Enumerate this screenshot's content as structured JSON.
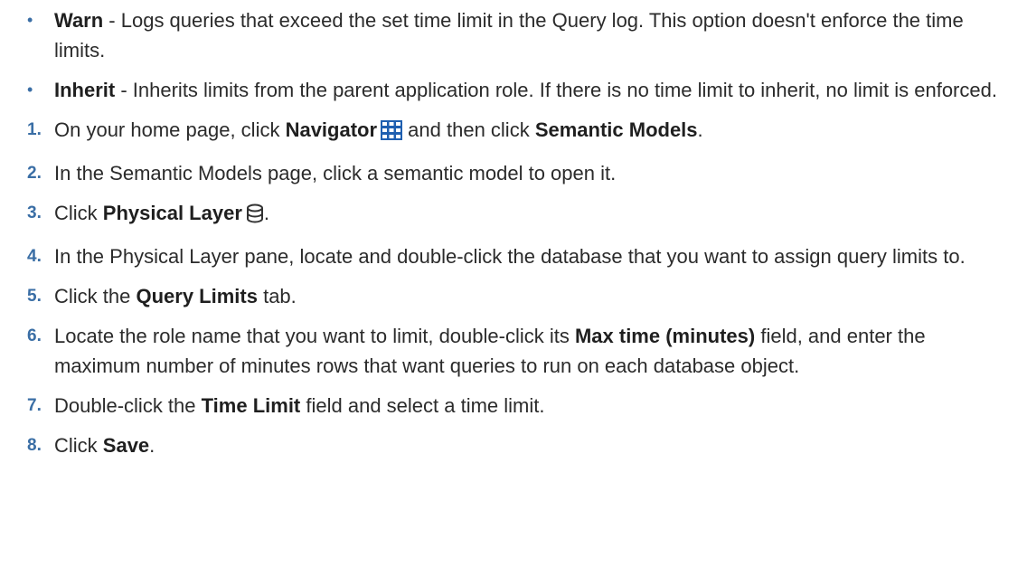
{
  "bullets": [
    {
      "term": "Warn",
      "text": " - Logs queries that exceed the set time limit in the Query log. This option doesn't enforce the time limits."
    },
    {
      "term": "Inherit",
      "text": " - Inherits limits from the parent application role. If there is no time limit to inherit, no limit is enforced."
    }
  ],
  "steps": [
    {
      "num": "1.",
      "pre": "On your home page, click ",
      "bold1": "Navigator",
      "mid": " and then click ",
      "bold2": "Semantic Models",
      "post": "."
    },
    {
      "num": "2.",
      "text": "In the Semantic Models page, click a semantic model to open it."
    },
    {
      "num": "3.",
      "pre": "Click ",
      "bold1": "Physical Layer",
      "post": "."
    },
    {
      "num": "4.",
      "text": "In the Physical Layer pane, locate and double-click the database that you want to assign query limits to."
    },
    {
      "num": "5.",
      "pre": "Click the ",
      "bold1": "Query Limits",
      "post": " tab."
    },
    {
      "num": "6.",
      "pre": "Locate the role name that you want to limit, double-click its ",
      "bold1": "Max time (minutes)",
      "post": " field, and enter the maximum number of minutes rows that want queries to run on each database object."
    },
    {
      "num": "7.",
      "pre": "Double-click the ",
      "bold1": "Time Limit",
      "post": " field and select a time limit."
    },
    {
      "num": "8.",
      "pre": "Click ",
      "bold1": "Save",
      "post": "."
    }
  ],
  "icons": {
    "navigator": "grid-icon",
    "physical_layer": "database-icon"
  },
  "colors": {
    "list_marker": "#3a6ea5",
    "navigator_icon": "#1f5fb0"
  }
}
